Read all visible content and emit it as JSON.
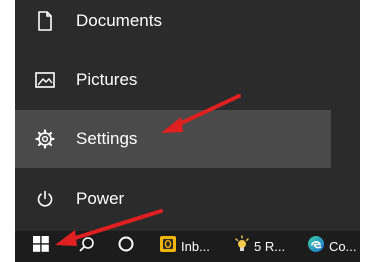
{
  "start_menu": {
    "items": [
      {
        "label": "Documents",
        "icon": "document-icon"
      },
      {
        "label": "Pictures",
        "icon": "pictures-icon"
      },
      {
        "label": "Settings",
        "icon": "gear-icon",
        "highlighted": true
      },
      {
        "label": "Power",
        "icon": "power-icon"
      }
    ]
  },
  "taskbar": {
    "apps": [
      {
        "label": "Inb...",
        "icon": "outlook-icon"
      },
      {
        "label": "5 R...",
        "icon": "lightbulb-icon"
      },
      {
        "label": "Co...",
        "icon": "edge-icon"
      }
    ]
  },
  "colors": {
    "menu_bg": "#2b2b2b",
    "highlight_bg": "#4a4a4a",
    "taskbar_bg": "#1c1c1c",
    "arrow": "#e02020",
    "text": "#ffffff"
  }
}
